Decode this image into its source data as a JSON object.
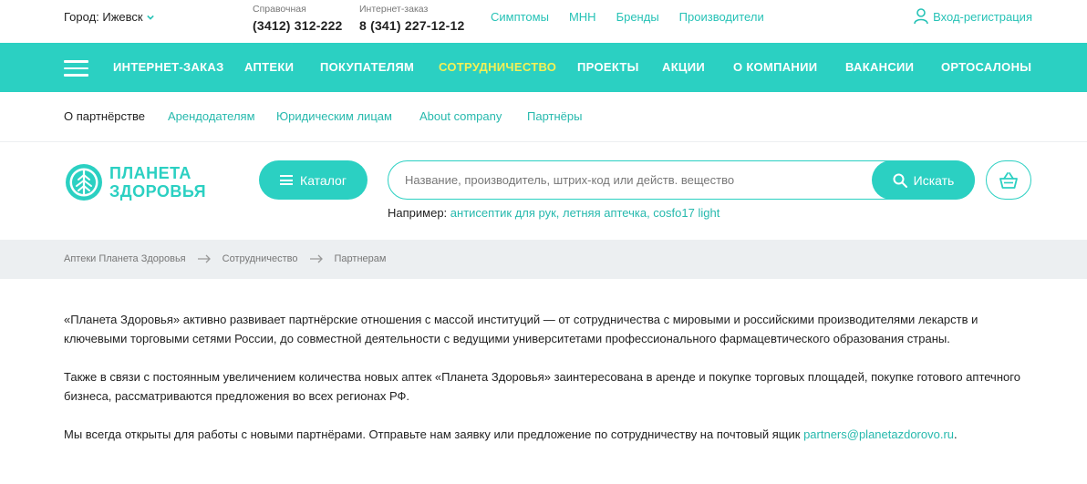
{
  "topbar": {
    "city": "Город: Ижевск",
    "phones": [
      {
        "caption": "Справочная",
        "number": "(3412) 312-222"
      },
      {
        "caption": "Интернет-заказ",
        "number": "8 (341) 227-12-12"
      }
    ],
    "links": [
      "Симптомы",
      "МНН",
      "Бренды",
      "Производители"
    ],
    "login": "Вход-регистрация"
  },
  "mainnav": {
    "items": [
      "ИНТЕРНЕТ-ЗАКАЗ",
      "АПТЕКИ",
      "ПОКУПАТЕЛЯМ",
      "СОТРУДНИЧЕСТВО",
      "ПРОЕКТЫ",
      "АКЦИИ",
      "О КОМПАНИИ",
      "ВАКАНСИИ",
      "ОРТОСАЛОНЫ"
    ],
    "active": "СОТРУДНИЧЕСТВО"
  },
  "subnav": {
    "items": [
      "О партнёрстве",
      "Арендодателям",
      "Юридическим лицам",
      "About company",
      "Партнёры"
    ]
  },
  "header": {
    "logo_line1": "ПЛАНЕТА",
    "logo_line2": "ЗДОРОВЬЯ",
    "catalog_label": "Каталог",
    "search_placeholder": "Название, производитель, штрих-код или действ. вещество",
    "search_button": "Искать",
    "example_prefix": "Например:",
    "example_links": "антисептик для рук, летняя аптечка, cosfo17 light"
  },
  "breadcrumb": [
    "Аптеки Планета Здоровья",
    "Сотрудничество",
    "Партнерам"
  ],
  "content": {
    "p1": "«Планета Здоровья» активно развивает партнёрские отношения с массой институций — от сотрудничества с мировыми и российскими производителями лекарств и ключевыми торговыми сетями России, до совместной деятельности с ведущими университетами профессионального фармацевтического образования страны.",
    "p2": "Также в связи с постоянным увеличением количества новых аптек «Планета Здоровья» заинтересована в аренде и покупке торговых площадей, покупке готового аптечного бизнеса, рассматриваются предложения во всех регионах РФ.",
    "p3_text": "Мы всегда открыты для работы с новыми партнёрами. Отправьте нам заявку или предложение по сотрудничеству на почтовый ящик",
    "p3_email": "partners@planetazdorovo.ru",
    "p3_end": "."
  },
  "colors": {
    "accent": "#2bd0c2",
    "link": "#26b9ad",
    "active_nav": "#f4f055",
    "breadcrumb_bg": "#eceff1"
  },
  "icons": [
    "chevron-down-icon",
    "user-icon",
    "hamburger-icon",
    "logo-tree-icon",
    "search-icon",
    "basket-icon",
    "arrow-right-icon"
  ]
}
